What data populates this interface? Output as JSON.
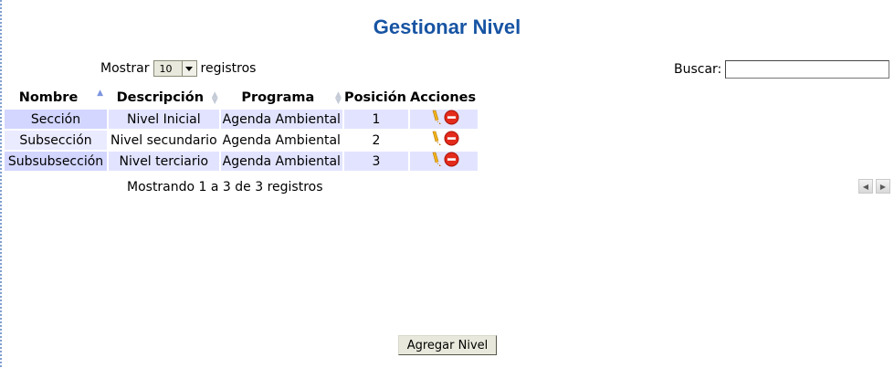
{
  "title": "Gestionar Nivel",
  "length_menu": {
    "prefix": "Mostrar",
    "value": "10",
    "suffix": "registros"
  },
  "filter": {
    "label": "Buscar:",
    "value": ""
  },
  "table": {
    "columns": [
      "Nombre",
      "Descripción",
      "Programa",
      "Posición",
      "Acciones"
    ],
    "rows": [
      {
        "nombre": "Sección",
        "descripcion": "Nivel Inicial",
        "programa": "Agenda Ambiental",
        "posicion": "1"
      },
      {
        "nombre": "Subsección",
        "descripcion": "Nivel secundario",
        "programa": "Agenda Ambiental",
        "posicion": "2"
      },
      {
        "nombre": "Subsubsección",
        "descripcion": "Nivel terciario",
        "programa": "Agenda Ambiental",
        "posicion": "3"
      }
    ],
    "row_actions": [
      "edit-icon",
      "delete-icon"
    ]
  },
  "info": "Mostrando 1 a 3 de 3 registros",
  "pagination": {
    "previous": "◀",
    "next": "▶"
  },
  "add_button": "Agregar Nivel",
  "colors": {
    "title": "#1754a3",
    "row_odd": "#e2e4ff",
    "row_odd_sorted": "#d3d6ff",
    "sort_active": "#7d95df",
    "button_face": "#e8e8dc"
  }
}
